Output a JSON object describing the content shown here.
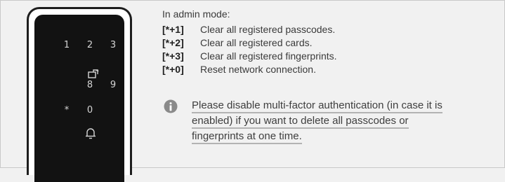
{
  "lock": {
    "keys": [
      "1",
      "2",
      "3",
      "8",
      "9",
      "*",
      "0"
    ],
    "icons": [
      "door-icon",
      "bell-icon"
    ]
  },
  "instructions": {
    "intro": "In admin mode:",
    "items": [
      {
        "code": "[*+1]",
        "text": "Clear all registered passcodes."
      },
      {
        "code": "[*+2]",
        "text": "Clear all registered cards."
      },
      {
        "code": "[*+3]",
        "text": "Clear all registered fingerprints."
      },
      {
        "code": "[*+0]",
        "text": "Reset network connection."
      }
    ]
  },
  "note": {
    "icon": "info-icon",
    "lines": [
      "Please disable multi-factor authentication (in case it is",
      "enabled) if you want to delete all passcodes or",
      "fingerprints at one time."
    ]
  },
  "colors": {
    "background": "#f1f1f1",
    "device_frame": "#1d1d1d",
    "keypad_face": "#121212",
    "key_glyph": "#d6d6d6",
    "info_icon": "#8a8a8a"
  }
}
